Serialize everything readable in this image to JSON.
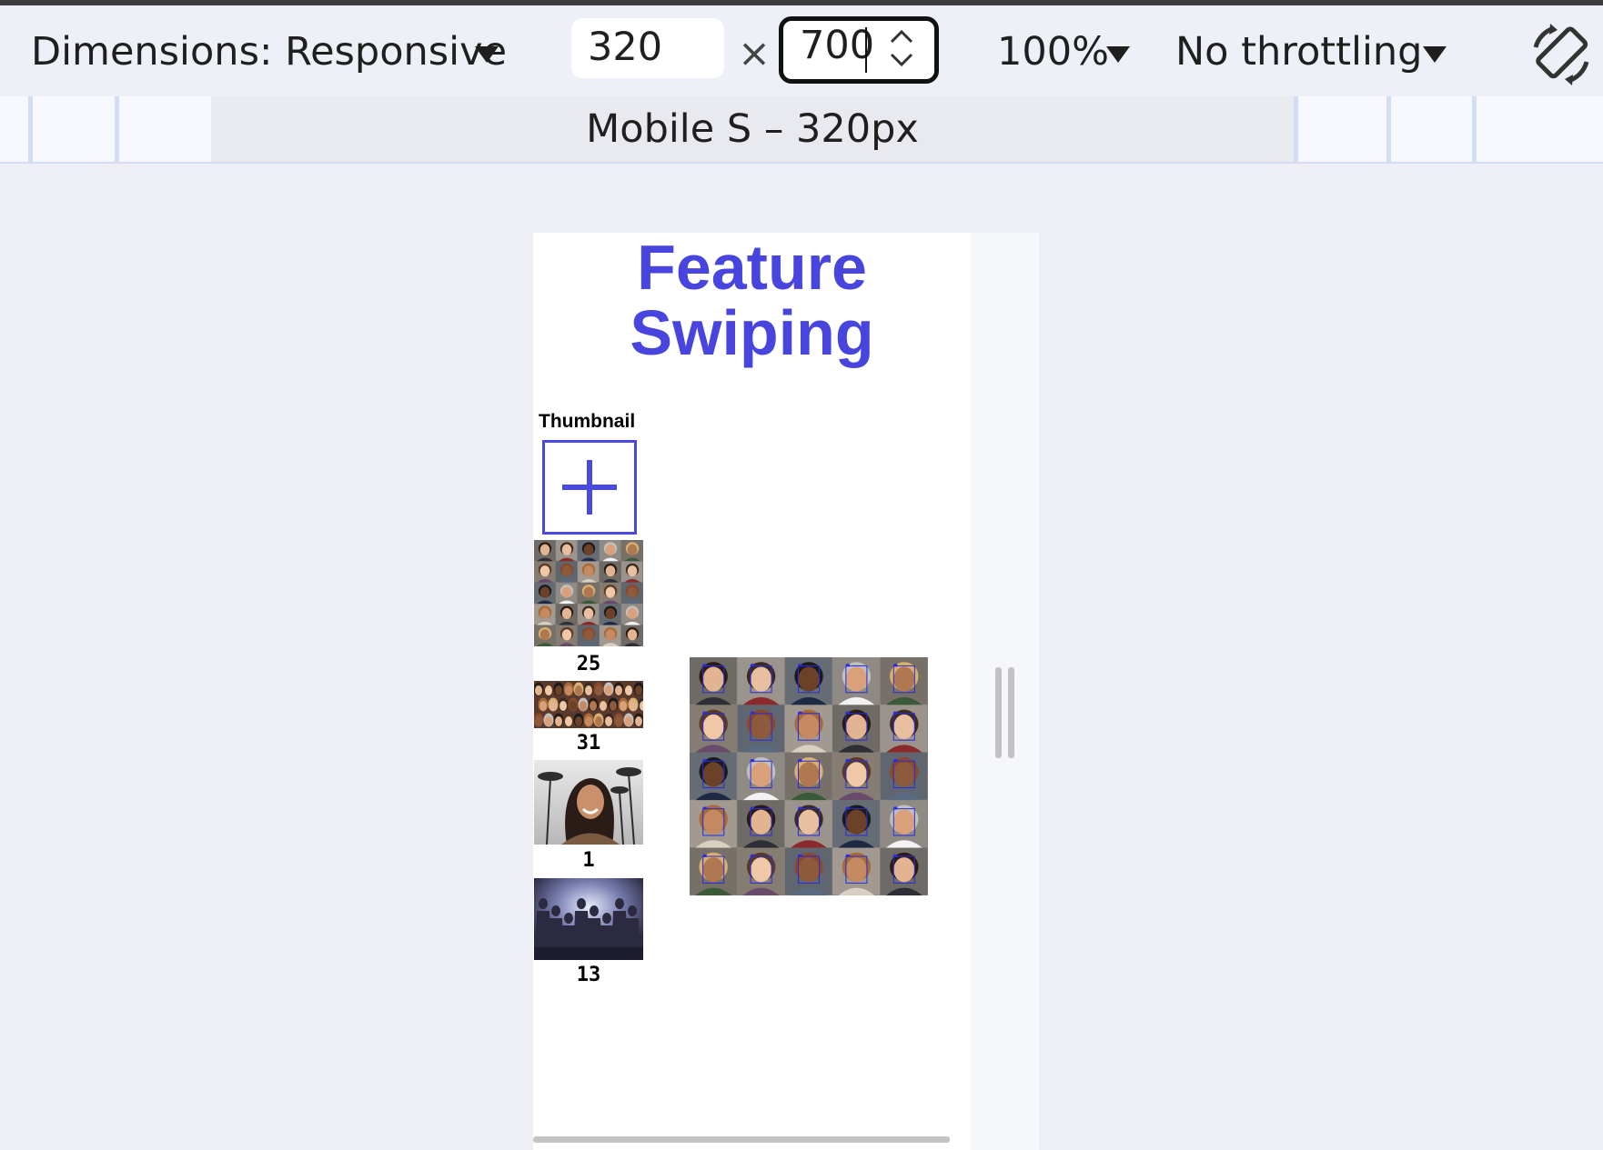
{
  "devtools": {
    "dimensions_label": "Dimensions: Responsive",
    "width_value": "320",
    "times_sign": "×",
    "height_value": "700",
    "zoom_label": "100%",
    "throttling_label": "No throttling",
    "preset_label": "Mobile S – 320px"
  },
  "page": {
    "title_line1": "Feature",
    "title_line2": "Swiping",
    "thumbnail_heading": "Thumbnail",
    "thumbnails": [
      {
        "count": "25",
        "description": "grid of portrait photos"
      },
      {
        "count": "31",
        "description": "crowd of faces"
      },
      {
        "count": "1",
        "description": "smiling woman under palm trees"
      },
      {
        "count": "13",
        "description": "group of costumed heroes"
      }
    ]
  },
  "colors": {
    "title": "#4845df",
    "add_border": "#4a4ae0",
    "face_box": "#2a2adf"
  },
  "icons": [
    "chevron-down-icon",
    "spin-up-icon",
    "spin-down-icon",
    "rotate-icon",
    "plus-icon",
    "resize-handle-icon"
  ]
}
